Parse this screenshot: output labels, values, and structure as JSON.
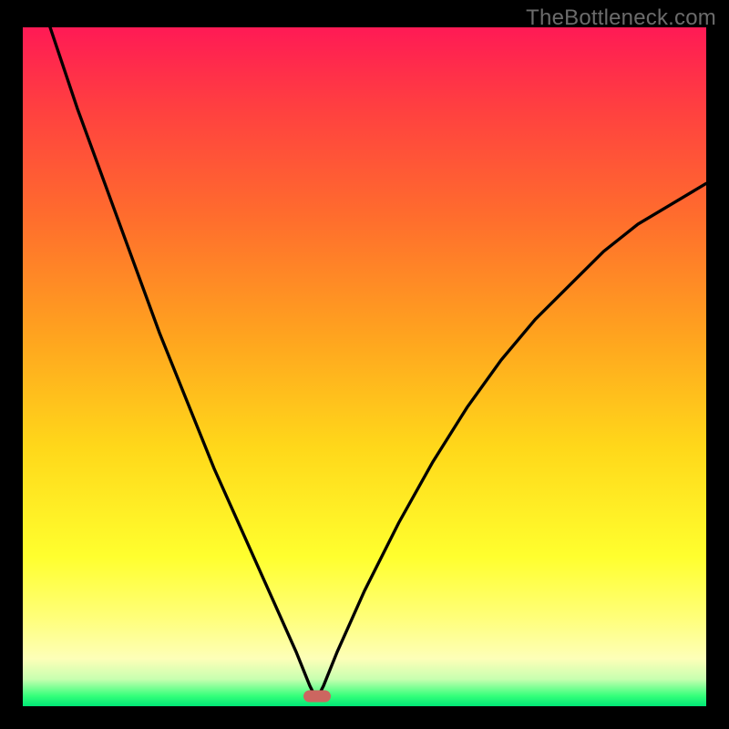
{
  "watermark": "TheBottleneck.com",
  "colors": {
    "page_bg": "#000000",
    "curve_stroke": "#000000",
    "marker_fill": "#cc6660",
    "watermark_text": "#6b6b6b",
    "gradient_stops": [
      "#ff1a55",
      "#ff4040",
      "#ff6d2d",
      "#ffa21f",
      "#ffd81a",
      "#ffff2e",
      "#ffff7a",
      "#fdffb8",
      "#c8ffb0",
      "#34ff7a",
      "#00e676"
    ]
  },
  "chart_data": {
    "type": "line",
    "title": "",
    "xlabel": "",
    "ylabel": "",
    "xlim": [
      0,
      100
    ],
    "ylim": [
      0,
      100
    ],
    "background": "vertical-gradient red→yellow→green (y=100 red at top, y=0 green at bottom)",
    "marker": {
      "x": 43,
      "y": 2,
      "shape": "rounded-rect",
      "fill": "#cc6660"
    },
    "series": [
      {
        "name": "left-branch",
        "x": [
          4,
          8,
          12,
          16,
          20,
          24,
          28,
          32,
          36,
          40,
          42,
          43
        ],
        "y": [
          100,
          88,
          77,
          66,
          55,
          45,
          35,
          26,
          17,
          8,
          3,
          1
        ]
      },
      {
        "name": "right-branch",
        "x": [
          43,
          44,
          46,
          50,
          55,
          60,
          65,
          70,
          75,
          80,
          85,
          90,
          95,
          100
        ],
        "y": [
          1,
          3,
          8,
          17,
          27,
          36,
          44,
          51,
          57,
          62,
          67,
          71,
          74,
          77
        ]
      }
    ],
    "annotations": [
      {
        "text": "TheBottleneck.com",
        "role": "watermark",
        "position": "top-right"
      }
    ]
  }
}
